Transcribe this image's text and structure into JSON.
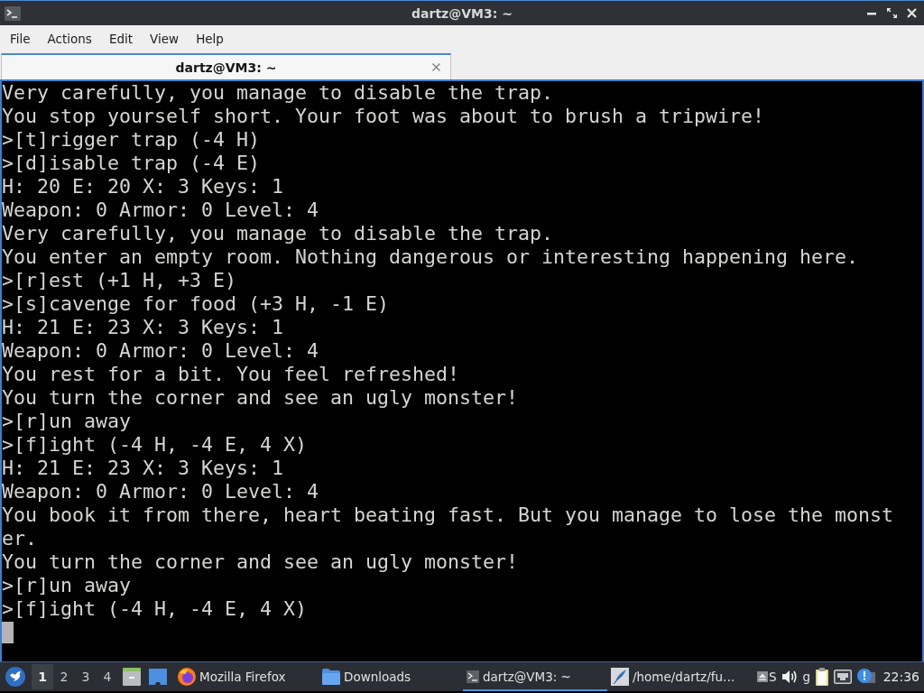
{
  "window": {
    "title": "dartz@VM3: ~"
  },
  "menu": [
    "File",
    "Actions",
    "Edit",
    "View",
    "Help"
  ],
  "tabs": [
    {
      "label": "dartz@VM3: ~",
      "selected": true
    }
  ],
  "terminal": {
    "lines": [
      "Very carefully, you manage to disable the trap.",
      "You stop yourself short. Your foot was about to brush a tripwire!",
      ">[t]rigger trap (-4 H)",
      ">[d]isable trap (-4 E)",
      "H: 20 E: 20 X: 3 Keys: 1",
      "Weapon: 0 Armor: 0 Level: 4",
      "Very carefully, you manage to disable the trap.",
      "You enter an empty room. Nothing dangerous or interesting happening here.",
      ">[r]est (+1 H, +3 E)",
      ">[s]cavenge for food (+3 H, -1 E)",
      "H: 21 E: 23 X: 3 Keys: 1",
      "Weapon: 0 Armor: 0 Level: 4",
      "You rest for a bit. You feel refreshed!",
      "You turn the corner and see an ugly monster!",
      ">[r]un away",
      ">[f]ight (-4 H, -4 E, 4 X)",
      "H: 21 E: 23 X: 3 Keys: 1",
      "Weapon: 0 Armor: 0 Level: 4",
      "You book it from there, heart beating fast. But you manage to lose the monster.",
      "You turn the corner and see an ugly monster!",
      ">[r]un away",
      ">[f]ight (-4 H, -4 E, 4 X)"
    ]
  },
  "taskbar": {
    "workspaces": [
      {
        "label": "1",
        "selected": true
      },
      {
        "label": "2",
        "selected": false
      },
      {
        "label": "3",
        "selected": false
      },
      {
        "label": "4",
        "selected": false
      }
    ],
    "tasks": [
      {
        "kind": "browser",
        "label": "Mozilla Firefox",
        "selected": false
      },
      {
        "kind": "folder",
        "label": "Downloads",
        "selected": false
      },
      {
        "kind": "terminal",
        "label": "dartz@VM3: ~",
        "selected": true
      },
      {
        "kind": "editor",
        "label": "/home/dartz/fu…",
        "selected": false
      }
    ],
    "tray": [
      {
        "kind": "eject",
        "label": "S"
      },
      {
        "kind": "volume"
      },
      {
        "kind": "text",
        "label": "g"
      },
      {
        "kind": "clipboard"
      },
      {
        "kind": "network"
      },
      {
        "kind": "notification"
      }
    ],
    "clock": "22:36"
  }
}
